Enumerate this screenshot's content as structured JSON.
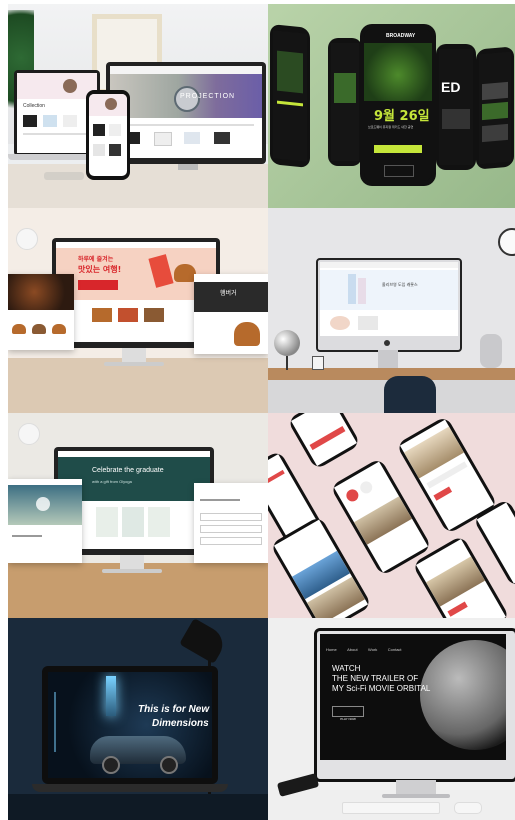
{
  "panel1": {
    "hero_text": "PROJECTION",
    "mini_title": "Collection",
    "colors": {
      "bg": "#eceef0",
      "desk": "#e8e3dc",
      "accent": "#6b5ea8"
    }
  },
  "panel2": {
    "brand": "BROADWAY",
    "date": "9월 26일",
    "subtitle": "브로드웨이 뮤지컬 위키드 내한 공연",
    "cta": "GET TICKETS",
    "side_text": "ED",
    "colors": {
      "bg": "#a9c59a",
      "screen": "#111",
      "accent": "#c5e63a"
    }
  },
  "panel3": {
    "hero_line1": "하루에 즐겨는",
    "hero_line2": "맛있는 여행!",
    "side_title": "햄버거",
    "colors": {
      "bg": "#f4ede6",
      "hero": "#f3c6b5",
      "accent": "#d8262b"
    }
  },
  "panel4": {
    "headline": "올리브영 도입 캐롯스",
    "logo": "",
    "colors": {
      "bg": "#e6e6e8",
      "desk": "#b98a5e"
    }
  },
  "panel5": {
    "headline": "Celebrate the graduate",
    "subline": "with a gift from Olyoga",
    "colors": {
      "bg": "#ebe9e4",
      "hero": "#1f4c49",
      "desk": "#c79d6e"
    }
  },
  "panel6": {
    "colors": {
      "bg": "#f0dcdc",
      "card": "#ffffff",
      "accent": "#e04848"
    }
  },
  "panel7": {
    "headline_line1": "This is for New",
    "headline_line2": "Dimensions",
    "colors": {
      "bg": "#1a2a3b",
      "screen": "#0c1826",
      "accent": "#7ad2ff"
    }
  },
  "panel8": {
    "nav": [
      "Home",
      "About",
      "Work",
      "Contact"
    ],
    "headline_line1": "WATCH",
    "headline_line2": "THE NEW TRAILER OF",
    "headline_line3": "MY Sci-Fi MOVIE ORBITAL",
    "button": "PLAY NOW",
    "colors": {
      "bg": "#efefef",
      "screen": "#0d0d0d",
      "moon": "#8a8a8a"
    }
  }
}
